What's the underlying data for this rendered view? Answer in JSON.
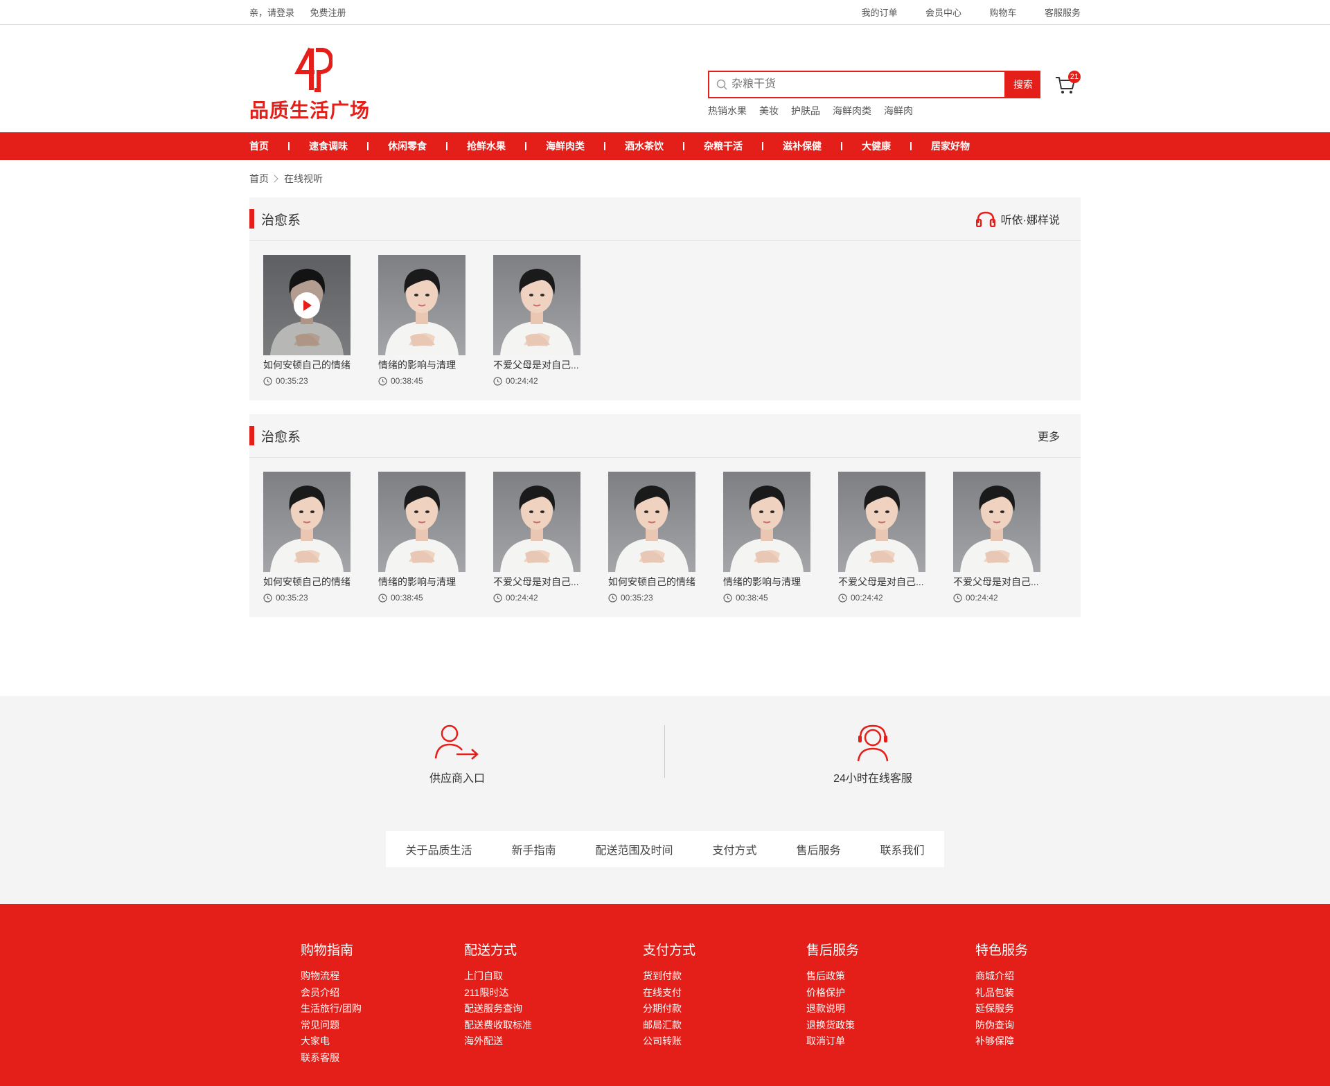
{
  "topbar": {
    "login": "亲，请登录",
    "register": "免费注册",
    "links": [
      "我的订单",
      "会员中心",
      "购物车",
      "客服服务"
    ]
  },
  "logo": {
    "text": "品质生活广场",
    "mark": "P"
  },
  "search": {
    "placeholder": "杂粮干货",
    "button": "搜索",
    "hot": [
      "热销水果",
      "美妆",
      "护肤品",
      "海鲜肉类",
      "海鲜肉"
    ]
  },
  "cart": {
    "count": "21"
  },
  "nav": [
    "首页",
    "速食调味",
    "休闲零食",
    "抢鲜水果",
    "海鲜肉类",
    "酒水茶饮",
    "杂粮干活",
    "滋补保健",
    "大健康",
    "居家好物"
  ],
  "breadcrumb": {
    "home": "首页",
    "current": "在线视听"
  },
  "sections": [
    {
      "title": "治愈系",
      "right": "听依·娜样说",
      "items": [
        {
          "title": "如何安顿自己的情绪",
          "time": "00:35:23",
          "playing": true
        },
        {
          "title": "情绪的影响与清理",
          "time": "00:38:45"
        },
        {
          "title": "不爱父母是对自己...",
          "time": "00:24:42"
        }
      ]
    },
    {
      "title": "治愈系",
      "right": "更多",
      "items": [
        {
          "title": "如何安顿自己的情绪",
          "time": "00:35:23"
        },
        {
          "title": "情绪的影响与清理",
          "time": "00:38:45"
        },
        {
          "title": "不爱父母是对自己...",
          "time": "00:24:42"
        },
        {
          "title": "如何安顿自己的情绪",
          "time": "00:35:23"
        },
        {
          "title": "情绪的影响与清理",
          "time": "00:38:45"
        },
        {
          "title": "不爱父母是对自己...",
          "time": "00:24:42"
        },
        {
          "title": "不爱父母是对自己...",
          "time": "00:24:42"
        }
      ]
    }
  ],
  "service": {
    "supplier": "供应商入口",
    "support": "24小时在线客服",
    "links": [
      "关于品质生活",
      "新手指南",
      "配送范围及时间",
      "支付方式",
      "售后服务",
      "联系我们"
    ]
  },
  "footer": [
    {
      "title": "购物指南",
      "items": [
        "购物流程",
        "会员介绍",
        "生活旅行/团购",
        "常见问题",
        "大家电",
        "联系客服"
      ]
    },
    {
      "title": "配送方式",
      "items": [
        "上门自取",
        "211限时达",
        "配送服务查询",
        "配送费收取标准",
        "海外配送"
      ]
    },
    {
      "title": "支付方式",
      "items": [
        "货到付款",
        "在线支付",
        "分期付款",
        "邮局汇款",
        "公司转账"
      ]
    },
    {
      "title": "售后服务",
      "items": [
        "售后政策",
        "价格保护",
        "退款说明",
        "退换货政策",
        "取消订单"
      ]
    },
    {
      "title": "特色服务",
      "items": [
        "商城介绍",
        "礼品包装",
        "延保服务",
        "防伪查询",
        "补够保障"
      ]
    }
  ],
  "colors": {
    "brand": "#e41f19",
    "panel": "#f5f5f5"
  }
}
